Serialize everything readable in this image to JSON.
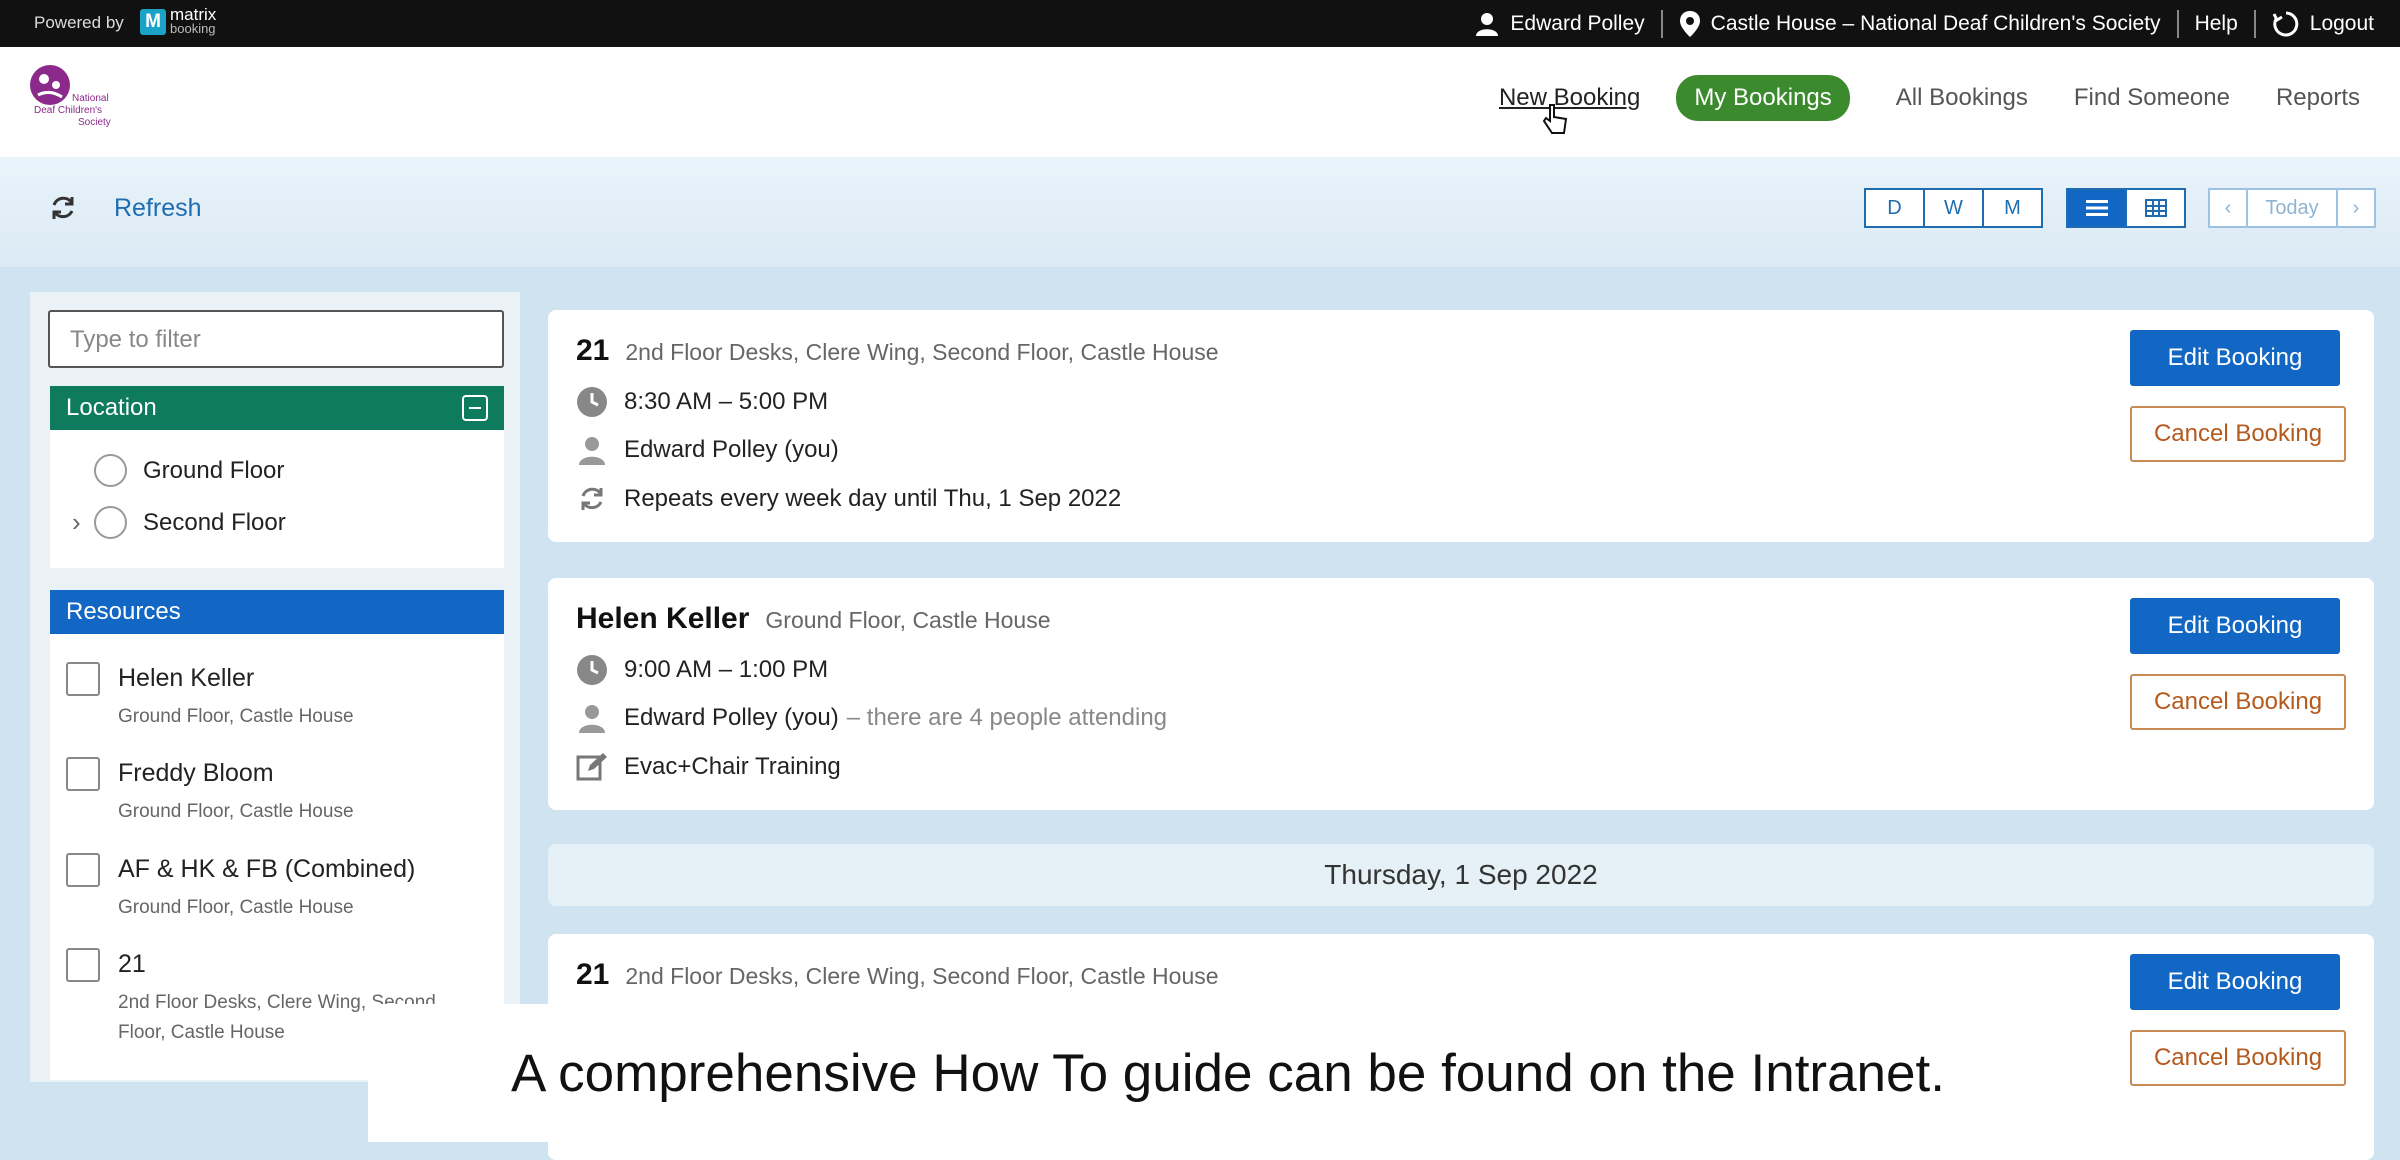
{
  "topbar": {
    "powered_by": "Powered by",
    "brand_top": "matrix",
    "brand_bottom": "booking",
    "user": "Edward Polley",
    "location": "Castle House – National Deaf Children's Society",
    "help": "Help",
    "logout": "Logout"
  },
  "header": {
    "logo_text": [
      "National",
      "Deaf Children's",
      "Society"
    ],
    "nav": {
      "new_booking": "New Booking",
      "my_bookings": "My Bookings",
      "all_bookings": "All Bookings",
      "find_someone": "Find Someone",
      "reports": "Reports"
    },
    "accent_color": "#3b8a2d"
  },
  "toolbar": {
    "refresh": "Refresh",
    "day": "D",
    "week": "W",
    "month": "M",
    "today": "Today",
    "prev": "‹",
    "next": "›"
  },
  "sidebar": {
    "filter_placeholder": "Type to filter",
    "location_title": "Location",
    "locations": [
      "Ground Floor",
      "Second Floor"
    ],
    "resources_title": "Resources",
    "resources": [
      {
        "name": "Helen Keller",
        "sub": "Ground Floor, Castle House"
      },
      {
        "name": "Freddy Bloom",
        "sub": "Ground Floor, Castle House"
      },
      {
        "name": "AF & HK & FB (Combined)",
        "sub": "Ground Floor, Castle House"
      },
      {
        "name": "21",
        "sub": "2nd Floor Desks, Clere Wing, Second",
        "sub2": "Floor, Castle House"
      }
    ]
  },
  "bookings": [
    {
      "title": "21",
      "location": "2nd Floor Desks, Clere Wing, Second Floor, Castle House",
      "time": "8:30 AM – 5:00 PM",
      "person": "Edward Polley (you)",
      "repeat": "Repeats every week day until Thu, 1 Sep 2022",
      "edit": "Edit Booking",
      "cancel": "Cancel Booking"
    },
    {
      "title": "Helen Keller",
      "location": "Ground Floor, Castle House",
      "time": "9:00 AM – 1:00 PM",
      "person": "Edward Polley (you)",
      "attending": "– there are 4 people attending",
      "note": "Evac+Chair Training",
      "edit": "Edit Booking",
      "cancel": "Cancel Booking"
    },
    {
      "title": "21",
      "location": "2nd Floor Desks, Clere Wing, Second Floor, Castle House",
      "edit": "Edit Booking",
      "cancel": "Cancel Booking"
    }
  ],
  "day_header": "Thursday, 1 Sep 2022",
  "caption": "A comprehensive How To guide can be found on the Intranet."
}
